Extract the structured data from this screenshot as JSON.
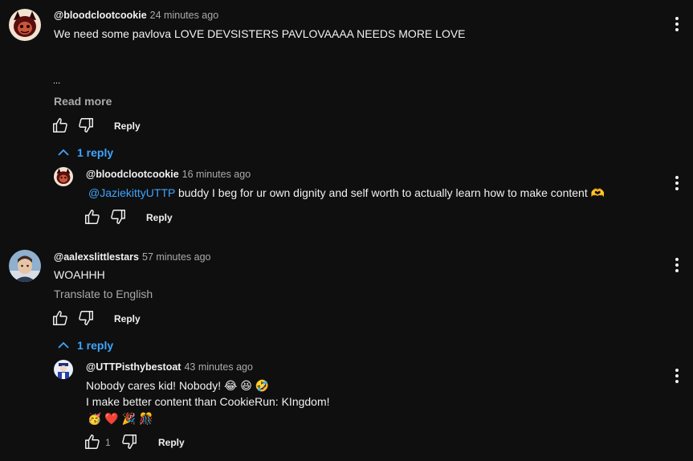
{
  "comments": [
    {
      "author": "@bloodclootcookie",
      "time": "24 minutes ago",
      "text": "We need some pavlova LOVE DEVSISTERS PAVLOVAAAA NEEDS MORE LOVE",
      "ellipsis": "...",
      "read_more": "Read more",
      "reply_label": "Reply",
      "replies_toggle": "1 reply",
      "replies": [
        {
          "author": "@bloodclootcookie",
          "time": "16 minutes ago",
          "mention": "@JaziekittyUTTP",
          "text": " buddy I beg for ur own dignity and self worth to actually learn how to make content 🫶",
          "reply_label": "Reply"
        }
      ]
    },
    {
      "author": "@aalexslittlestars",
      "time": "57 minutes ago",
      "text": "WOAHHH",
      "translate": "Translate to English",
      "reply_label": "Reply",
      "replies_toggle": "1 reply",
      "replies": [
        {
          "author": "@UTTPisthybestoat",
          "time": "43 minutes ago",
          "line1": "Nobody cares kid! Nobody! 😂 😆 🤣",
          "line2": "I make better content than CookieRun: KIngdom!",
          "emojis": "🥳 ❤️ 🎉 🎊",
          "likes": "1",
          "reply_label": "Reply"
        }
      ]
    }
  ],
  "colors": {
    "background": "#0f0f0f",
    "text": "#f1f1f1",
    "muted": "#aaaaaa",
    "link": "#3ea6ff"
  },
  "icons": {
    "like": "thumbs-up-icon",
    "dislike": "thumbs-down-icon",
    "more": "more-vertical-icon",
    "expand": "chevron-up-icon"
  }
}
